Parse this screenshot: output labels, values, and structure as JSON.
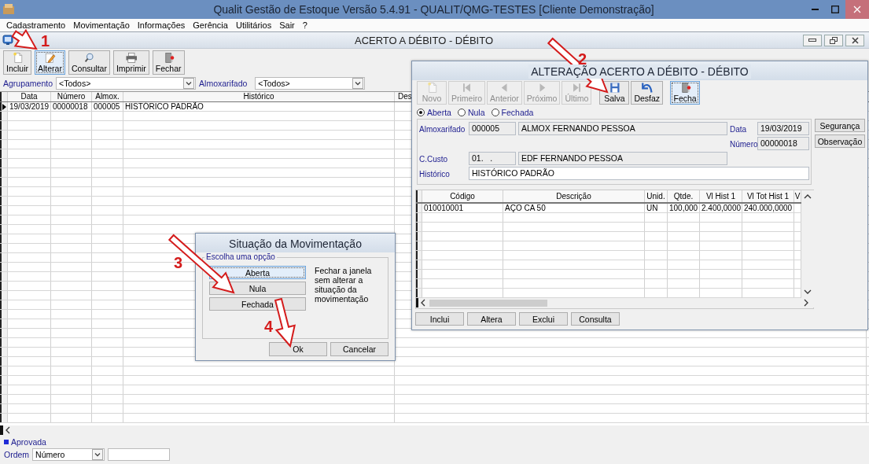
{
  "app_window": {
    "title": "Qualit Gestão de Estoque Versão 5.4.91 - QUALIT/QMG-TESTES [Cliente Demonstração]"
  },
  "menu": [
    {
      "label": "Cadastramento"
    },
    {
      "label": "Movimentação"
    },
    {
      "label": "Informações"
    },
    {
      "label": "Gerência"
    },
    {
      "label": "Utilitários"
    },
    {
      "label": "Sair"
    },
    {
      "label": "?"
    }
  ],
  "child_window": {
    "title": "ACERTO A DÉBITO - DÉBITO"
  },
  "toolbar": [
    {
      "label": "Incluir",
      "kind": "new",
      "focused": false
    },
    {
      "label": "Alterar",
      "kind": "edit",
      "focused": true
    },
    {
      "label": "Consultar",
      "kind": "search",
      "focused": false
    },
    {
      "label": "Imprimir",
      "kind": "print",
      "focused": false
    },
    {
      "label": "Fechar",
      "kind": "exit",
      "focused": false
    }
  ],
  "filters": [
    {
      "label": "Agrupamento",
      "value": "<Todos>"
    },
    {
      "label": "Almoxarifado",
      "value": "<Todos>"
    }
  ],
  "grid": {
    "columns": [
      "Data",
      "Número",
      "Almox.",
      "Histórico",
      "Des"
    ],
    "rows": [
      {
        "current": true,
        "cells": [
          "19/03/2019",
          "00000018",
          "000005",
          "HISTÓRICO PADRÃO"
        ]
      }
    ]
  },
  "legend": {
    "label": "Aprovada",
    "color": "#1f2bd6"
  },
  "order": {
    "label": "Ordem",
    "value": "Número"
  },
  "edit_dialog": {
    "title": "ALTERAÇÃO ACERTO A DÉBITO - DÉBITO",
    "toolbar": [
      {
        "label": "Novo",
        "kind": "new",
        "disabled": true,
        "focused": false
      },
      {
        "label": "Primeiro",
        "kind": "first",
        "disabled": true,
        "focused": false
      },
      {
        "label": "Anterior",
        "kind": "prev",
        "disabled": true,
        "focused": false
      },
      {
        "label": "Próximo",
        "kind": "next",
        "disabled": true,
        "focused": false
      },
      {
        "label": "Último",
        "kind": "last",
        "disabled": true,
        "focused": false
      },
      {
        "label": "Salva",
        "kind": "save",
        "disabled": false,
        "focused": false
      },
      {
        "label": "Desfaz",
        "kind": "undo",
        "disabled": false,
        "focused": false
      },
      {
        "label": "Fecha",
        "kind": "exit",
        "disabled": false,
        "focused": true
      }
    ],
    "status_options": [
      {
        "label": "Aberta",
        "selected": true
      },
      {
        "label": "Nula",
        "selected": false
      },
      {
        "label": "Fechada",
        "selected": false
      }
    ],
    "fields": {
      "almoxarifado": {
        "label": "Almoxarifado",
        "code": "000005",
        "name": "ALMOX FERNANDO PESSOA"
      },
      "data": {
        "label": "Data",
        "value": "19/03/2019"
      },
      "numero": {
        "label": "Número",
        "value": "00000018"
      },
      "c_custo": {
        "label": "C.Custo",
        "code": "01.   .",
        "name": "EDF FERNANDO PESSOA"
      },
      "historico": {
        "label": "Histórico",
        "value": "HISTÓRICO PADRÃO"
      }
    },
    "side_buttons": [
      "Segurança",
      "Observação"
    ],
    "items_grid": {
      "columns": [
        "Código",
        "Descrição",
        "Unid.",
        "Qtde.",
        "Vl Hist 1",
        "Vl Tot Hist 1",
        "V"
      ],
      "rows": [
        {
          "cells": [
            "010010001",
            "AÇO CA 50",
            "UN",
            "100,000",
            "2.400,0000",
            "240.000,0000"
          ]
        }
      ]
    },
    "buttons": [
      "Inclui",
      "Altera",
      "Exclui",
      "Consulta"
    ]
  },
  "status_dialog": {
    "title": "Situação da Movimentação",
    "group_label": "Escolha uma opção",
    "options": [
      {
        "label": "Aberta",
        "focused": true
      },
      {
        "label": "Nula",
        "focused": false
      },
      {
        "label": "Fechada",
        "focused": false
      }
    ],
    "hint": "Fechar a janela sem alterar a situação da movimentação",
    "buttons": [
      "Ok",
      "Cancelar"
    ]
  },
  "annotations": [
    {
      "number": "1"
    },
    {
      "number": "2"
    },
    {
      "number": "3"
    },
    {
      "number": "4"
    }
  ]
}
